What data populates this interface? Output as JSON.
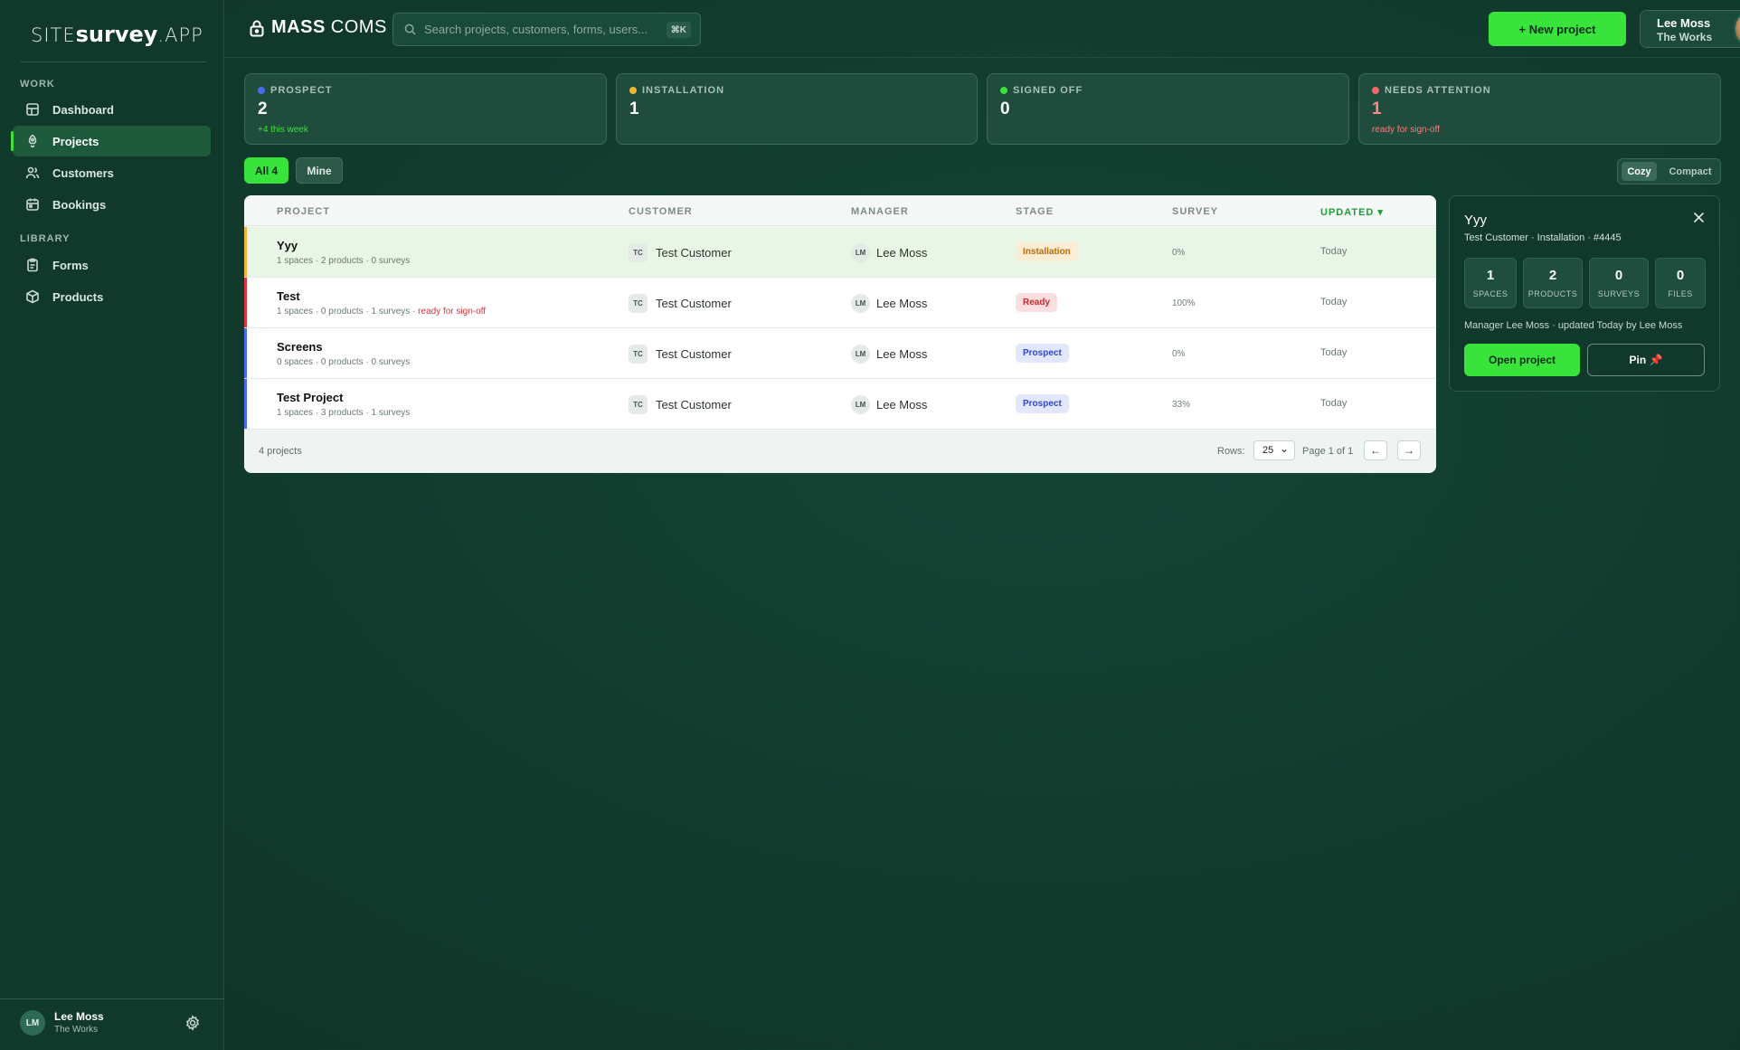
{
  "sidebar": {
    "logo": {
      "part1": "SITE",
      "part2": "survey",
      "part3": ".APP"
    },
    "sections": {
      "work": "WORK",
      "library": "LIBRARY"
    },
    "items": [
      {
        "label": "Dashboard",
        "icon": "dashboard-icon"
      },
      {
        "label": "Projects",
        "icon": "rocket-icon",
        "active": true
      },
      {
        "label": "Customers",
        "icon": "users-icon"
      },
      {
        "label": "Bookings",
        "icon": "calendar-icon"
      },
      {
        "label": "Forms",
        "icon": "clipboard-icon"
      },
      {
        "label": "Products",
        "icon": "box-icon"
      }
    ],
    "user": {
      "initials": "LM",
      "name": "Lee Moss",
      "org": "The Works"
    }
  },
  "header": {
    "brand_bold": "MASS",
    "brand_rest": "COMS",
    "search_placeholder": "Search projects, customers, forms, users...",
    "search_shortcut": "⌘K",
    "new_project_label": "+ New project",
    "user": {
      "name": "Lee Moss",
      "org": "The Works"
    }
  },
  "stats": [
    {
      "label": "PROSPECT",
      "value": "2",
      "sub": "+4 this week",
      "color": "#4b6cf0"
    },
    {
      "label": "INSTALLATION",
      "value": "1",
      "sub": "",
      "color": "#f0b43c"
    },
    {
      "label": "SIGNED OFF",
      "value": "0",
      "sub": "",
      "color": "#3ee03a"
    },
    {
      "label": "NEEDS ATTENTION",
      "value": "1",
      "sub": "ready for sign-off",
      "color": "#f06a6a"
    }
  ],
  "filters": {
    "all": "All 4",
    "mine": "Mine"
  },
  "density": {
    "cozy": "Cozy",
    "compact": "Compact"
  },
  "table": {
    "columns": {
      "project": "PROJECT",
      "customer": "CUSTOMER",
      "manager": "MANAGER",
      "stage": "STAGE",
      "survey": "SURVEY",
      "updated": "UPDATED ▾"
    },
    "rows": [
      {
        "name": "Yyy",
        "meta": "1 spaces · 2 products · 0 surveys",
        "warn": "",
        "customer_ini": "TC",
        "customer": "Test Customer",
        "manager_ini": "LM",
        "manager": "Lee Moss",
        "stage": "Installation",
        "survey": "0%",
        "updated": "Today"
      },
      {
        "name": "Test",
        "meta": "1 spaces · 0 products · 1 surveys · ",
        "warn": "ready for sign-off",
        "customer_ini": "TC",
        "customer": "Test Customer",
        "manager_ini": "LM",
        "manager": "Lee Moss",
        "stage": "Ready",
        "survey": "100%",
        "updated": "Today"
      },
      {
        "name": "Screens",
        "meta": "0 spaces · 0 products · 0 surveys",
        "warn": "",
        "customer_ini": "TC",
        "customer": "Test Customer",
        "manager_ini": "LM",
        "manager": "Lee Moss",
        "stage": "Prospect",
        "survey": "0%",
        "updated": "Today"
      },
      {
        "name": "Test Project",
        "meta": "1 spaces · 3 products · 1 surveys",
        "warn": "",
        "customer_ini": "TC",
        "customer": "Test Customer",
        "manager_ini": "LM",
        "manager": "Lee Moss",
        "stage": "Prospect",
        "survey": "33%",
        "updated": "Today"
      }
    ],
    "footer": {
      "count": "4 projects",
      "rows_label": "Rows:",
      "rows_value": "25",
      "page": "Page 1 of 1",
      "prev": "←",
      "next": "→"
    }
  },
  "detail": {
    "title": "Yyy",
    "subtitle": "Test Customer · Installation · #4445",
    "stats": [
      {
        "value": "1",
        "label": "SPACES"
      },
      {
        "value": "2",
        "label": "PRODUCTS"
      },
      {
        "value": "0",
        "label": "SURVEYS"
      },
      {
        "value": "0",
        "label": "FILES"
      }
    ],
    "manager_line": "Manager Lee Moss · updated Today by Lee Moss",
    "open_label": "Open project",
    "pin_label": "Pin 📌"
  }
}
